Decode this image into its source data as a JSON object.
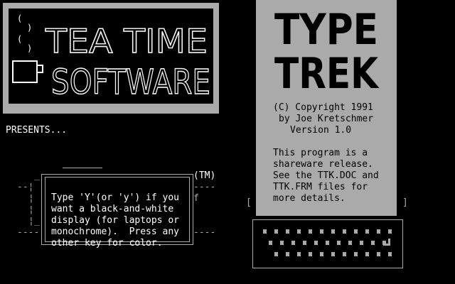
{
  "logo": {
    "line1": "TEA TIME",
    "line2": "SOFTWARE"
  },
  "presents": "PRESENTS...",
  "product": {
    "title_line1": "TYPE",
    "title_line2": "TREK",
    "copyright": "(C) Copyright 1991",
    "author": "by Joe Kretschmer",
    "version": "Version 1.0",
    "description_lines": [
      "This program is a",
      "shareware release.",
      "See the TTK.DOC and",
      "TTK.FRM files for",
      "more details."
    ]
  },
  "trademark": "(TM)",
  "dialog": {
    "lines": [
      "Type 'Y'(or 'y') if you",
      "want a black-and-white",
      "display (for laptops or",
      "monochrome).  Press any",
      "other key for color."
    ]
  },
  "colors": {
    "background": "#000000",
    "panel_gray": "#aaaaaa",
    "text_white": "#ffffff"
  }
}
